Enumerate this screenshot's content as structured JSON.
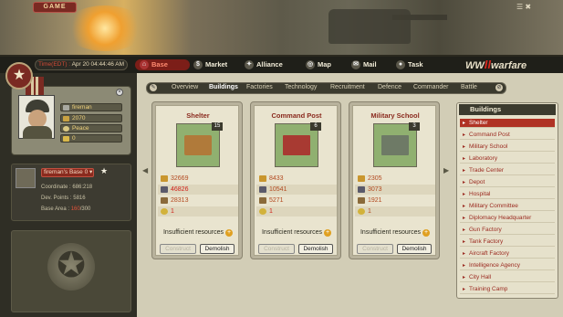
{
  "banner": {
    "game_label": "GAME",
    "icons": "☰ ✖"
  },
  "clock": {
    "label": "Time(EDT) :",
    "value": "Apr 20 04:44:46 AM"
  },
  "nav": [
    {
      "label": "Base",
      "icon": "home-icon"
    },
    {
      "label": "Market",
      "icon": "market-icon"
    },
    {
      "label": "Alliance",
      "icon": "alliance-icon"
    },
    {
      "label": "Map",
      "icon": "map-icon"
    },
    {
      "label": "Mail",
      "icon": "mail-icon"
    },
    {
      "label": "Task",
      "icon": "task-icon"
    }
  ],
  "logo": {
    "pre": "WW",
    "mid": "II",
    "post": "warfare"
  },
  "profile": {
    "name": "fireman",
    "points": "2070",
    "status": "Peace",
    "gold": "0"
  },
  "base": {
    "name": "fireman's Base",
    "badge": "0",
    "coordinate_label": "Coordinate :",
    "coordinate": "686:218",
    "dev_label": "Dev. Points :",
    "dev": "5816",
    "area_label": "Base Area :",
    "area_used": "160",
    "area_total": "/300"
  },
  "tabs": [
    "Overview",
    "Buildings",
    "Factories",
    "Technology",
    "Recruitment",
    "Defence",
    "Commander",
    "Battle"
  ],
  "active_tab": "Buildings",
  "cards": [
    {
      "title": "Shelter",
      "level": "15",
      "r1": "32669",
      "r2": "46826",
      "r3": "28313",
      "r4": "1",
      "msg": "Insufficient resources",
      "construct": "Construct",
      "demolish": "Demolish"
    },
    {
      "title": "Command Post",
      "level": "6",
      "r1": "8433",
      "r2": "10541",
      "r3": "5271",
      "r4": "1",
      "msg": "Insufficient resources",
      "construct": "Construct",
      "demolish": "Demolish"
    },
    {
      "title": "Military School",
      "level": "3",
      "r1": "2305",
      "r2": "3073",
      "r3": "1921",
      "r4": "1",
      "msg": "Insufficient resources",
      "construct": "Construct",
      "demolish": "Demolish"
    }
  ],
  "sidebar": {
    "title": "Buildings",
    "items": [
      "Shelter",
      "Command Post",
      "Military School",
      "Laboratory",
      "Trade Center",
      "Depot",
      "Hospital",
      "Military Committee",
      "Diplomacy Headquarter",
      "Gun Factory",
      "Tank Factory",
      "Aircraft Factory",
      "Intelligence Agency",
      "City Hall",
      "Training Camp"
    ]
  },
  "colors": {
    "accent": "#b03224",
    "resource_text": "#b34a20",
    "panel": "#d2cdb6"
  }
}
